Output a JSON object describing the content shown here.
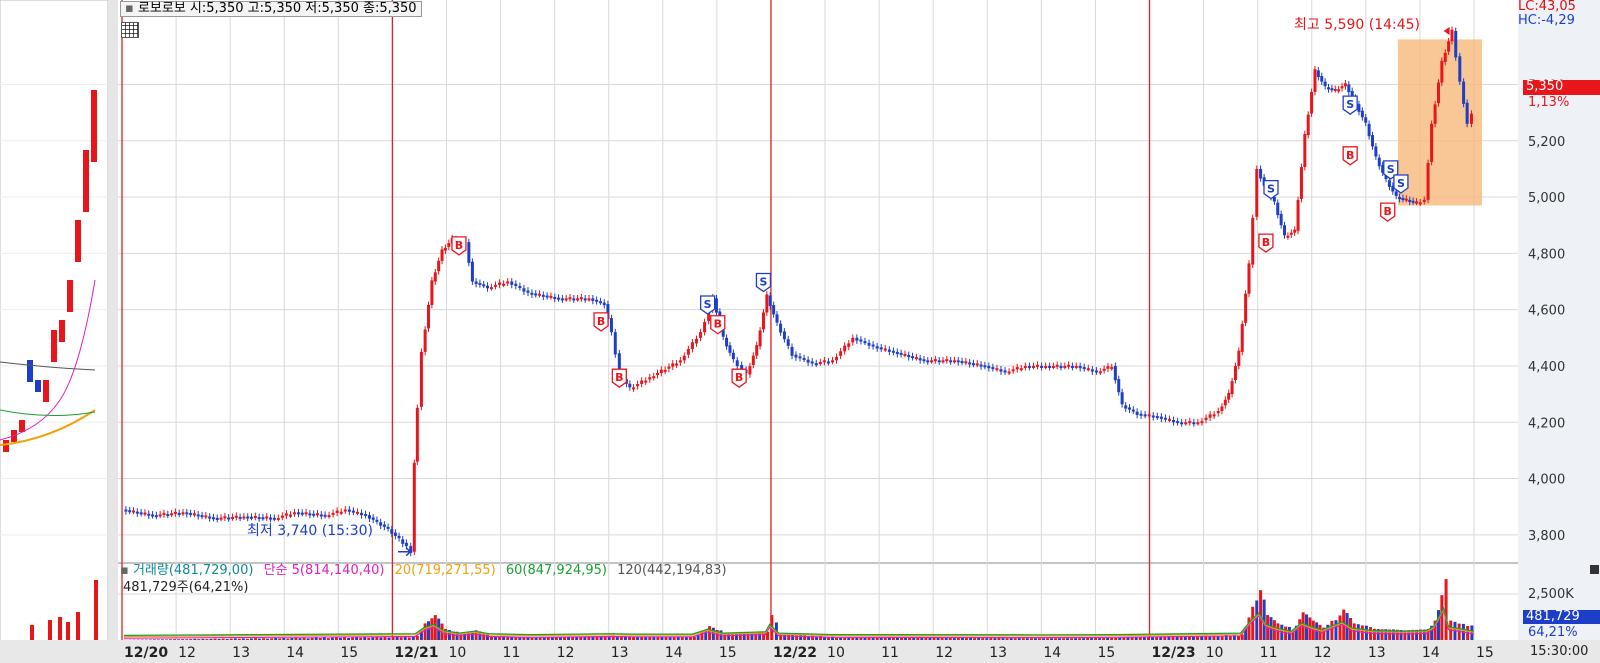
{
  "header": {
    "toggle": "▪",
    "info": "로보로보 시:5,350 고:5,350 저:5,350 종:5,350"
  },
  "corner": {
    "lc": "LC:43,05",
    "hc": "HC:-4,29"
  },
  "price_badge": {
    "value": "5,350",
    "change": "1,13%"
  },
  "annotations": {
    "high": "최고 5,590 (14:45)",
    "low": "최저 3,740 (15:30)"
  },
  "volume_header": {
    "volume": "거래량(481,729,00)",
    "ma5": "단순 5(814,140,40)",
    "ma20": "20(719,271,55)",
    "ma60": "60(847,924,95)",
    "ma120": "120(442,194,83)",
    "shares": "481,729주(64,21%)"
  },
  "volume_badge": {
    "value": "481,729",
    "pct": "64,21%"
  },
  "time_readout": "15:30:00",
  "colors": {
    "up": "#e8151b",
    "down": "#1d3fc8",
    "ma5": "#e020c0",
    "ma20": "#f2a20a",
    "ma60": "#1aa030",
    "ma120": "#555555",
    "volume_label": "#118899",
    "grid": "#d9d9d9",
    "session": "#e02020"
  },
  "chart_data": {
    "type": "candlestick",
    "title": "로보로보",
    "y_ticks": [
      "5,400",
      "5,200",
      "5,000",
      "4,800",
      "4,600",
      "4,400",
      "4,200",
      "4,000",
      "3,800"
    ],
    "y_range": [
      3700,
      5700
    ],
    "volume_ticks": [
      "2,500K"
    ],
    "x_ticks": [
      {
        "label": "12/20",
        "bold": true
      },
      {
        "label": "12"
      },
      {
        "label": "13"
      },
      {
        "label": "14"
      },
      {
        "label": "15"
      },
      {
        "label": "12/21",
        "bold": true
      },
      {
        "label": "10"
      },
      {
        "label": "11"
      },
      {
        "label": "12"
      },
      {
        "label": "13"
      },
      {
        "label": "14"
      },
      {
        "label": "15"
      },
      {
        "label": "12/22",
        "bold": true
      },
      {
        "label": "10"
      },
      {
        "label": "11"
      },
      {
        "label": "12"
      },
      {
        "label": "13"
      },
      {
        "label": "14"
      },
      {
        "label": "15"
      },
      {
        "label": "12/23",
        "bold": true
      },
      {
        "label": "10"
      },
      {
        "label": "11"
      },
      {
        "label": "12"
      },
      {
        "label": "13"
      },
      {
        "label": "14"
      },
      {
        "label": "15"
      }
    ],
    "price_path": [
      [
        0,
        3890
      ],
      [
        30,
        3870
      ],
      [
        60,
        3880
      ],
      [
        90,
        3860
      ],
      [
        120,
        3865
      ],
      [
        150,
        3860
      ],
      [
        170,
        3880
      ],
      [
        200,
        3870
      ],
      [
        220,
        3890
      ],
      [
        240,
        3870
      ],
      [
        262,
        3820
      ],
      [
        280,
        3760
      ],
      [
        285,
        3740
      ],
      [
        287,
        4060
      ],
      [
        295,
        4450
      ],
      [
        305,
        4700
      ],
      [
        315,
        4810
      ],
      [
        325,
        4850
      ],
      [
        338,
        4840
      ],
      [
        345,
        4700
      ],
      [
        360,
        4680
      ],
      [
        380,
        4700
      ],
      [
        400,
        4660
      ],
      [
        430,
        4640
      ],
      [
        460,
        4640
      ],
      [
        475,
        4620
      ],
      [
        482,
        4520
      ],
      [
        490,
        4370
      ],
      [
        500,
        4320
      ],
      [
        520,
        4360
      ],
      [
        550,
        4420
      ],
      [
        570,
        4520
      ],
      [
        582,
        4640
      ],
      [
        592,
        4500
      ],
      [
        602,
        4420
      ],
      [
        615,
        4370
      ],
      [
        625,
        4470
      ],
      [
        635,
        4650
      ],
      [
        645,
        4550
      ],
      [
        660,
        4440
      ],
      [
        680,
        4410
      ],
      [
        700,
        4420
      ],
      [
        720,
        4500
      ],
      [
        740,
        4470
      ],
      [
        760,
        4450
      ],
      [
        790,
        4420
      ],
      [
        820,
        4420
      ],
      [
        850,
        4400
      ],
      [
        870,
        4380
      ],
      [
        890,
        4400
      ],
      [
        910,
        4400
      ],
      [
        940,
        4400
      ],
      [
        960,
        4380
      ],
      [
        975,
        4400
      ],
      [
        985,
        4260
      ],
      [
        1000,
        4230
      ],
      [
        1020,
        4220
      ],
      [
        1040,
        4200
      ],
      [
        1060,
        4200
      ],
      [
        1080,
        4240
      ],
      [
        1090,
        4300
      ],
      [
        1100,
        4450
      ],
      [
        1110,
        4760
      ],
      [
        1118,
        5100
      ],
      [
        1125,
        5040
      ],
      [
        1135,
        4980
      ],
      [
        1145,
        4860
      ],
      [
        1155,
        4880
      ],
      [
        1165,
        5220
      ],
      [
        1175,
        5450
      ],
      [
        1185,
        5390
      ],
      [
        1195,
        5380
      ],
      [
        1205,
        5400
      ],
      [
        1215,
        5330
      ],
      [
        1225,
        5260
      ],
      [
        1235,
        5140
      ],
      [
        1245,
        5060
      ],
      [
        1255,
        5000
      ],
      [
        1265,
        4990
      ],
      [
        1275,
        4980
      ],
      [
        1283,
        4990
      ],
      [
        1290,
        5260
      ],
      [
        1300,
        5480
      ],
      [
        1310,
        5590
      ],
      [
        1318,
        5410
      ],
      [
        1325,
        5260
      ],
      [
        1330,
        5300
      ]
    ],
    "volume_path": [
      [
        0,
        10
      ],
      [
        287,
        150
      ],
      [
        295,
        600
      ],
      [
        305,
        900
      ],
      [
        315,
        400
      ],
      [
        330,
        200
      ],
      [
        345,
        350
      ],
      [
        360,
        150
      ],
      [
        400,
        80
      ],
      [
        480,
        150
      ],
      [
        500,
        120
      ],
      [
        560,
        120
      ],
      [
        575,
        500
      ],
      [
        590,
        200
      ],
      [
        632,
        300
      ],
      [
        636,
        900
      ],
      [
        645,
        200
      ],
      [
        700,
        80
      ],
      [
        900,
        60
      ],
      [
        975,
        80
      ],
      [
        1100,
        200
      ],
      [
        1110,
        1200
      ],
      [
        1118,
        1800
      ],
      [
        1125,
        900
      ],
      [
        1135,
        600
      ],
      [
        1150,
        350
      ],
      [
        1160,
        1000
      ],
      [
        1170,
        700
      ],
      [
        1180,
        450
      ],
      [
        1200,
        1100
      ],
      [
        1210,
        600
      ],
      [
        1230,
        400
      ],
      [
        1260,
        350
      ],
      [
        1283,
        400
      ],
      [
        1290,
        700
      ],
      [
        1300,
        2200
      ],
      [
        1305,
        700
      ],
      [
        1330,
        350
      ]
    ],
    "session_starts": [
      "12/21",
      "12/22",
      "12/23"
    ],
    "signals": [
      {
        "type": "B",
        "x": 330,
        "price": 4830
      },
      {
        "type": "B",
        "x": 470,
        "price": 4560
      },
      {
        "type": "B",
        "x": 488,
        "price": 4360
      },
      {
        "type": "S",
        "x": 575,
        "price": 4620
      },
      {
        "type": "B",
        "x": 585,
        "price": 4550
      },
      {
        "type": "B",
        "x": 606,
        "price": 4360
      },
      {
        "type": "S",
        "x": 630,
        "price": 4700
      },
      {
        "type": "S",
        "x": 1130,
        "price": 5030
      },
      {
        "type": "B",
        "x": 1125,
        "price": 4840
      },
      {
        "type": "S",
        "x": 1208,
        "price": 5330
      },
      {
        "type": "B",
        "x": 1208,
        "price": 5150
      },
      {
        "type": "S",
        "x": 1248,
        "price": 5100
      },
      {
        "type": "S",
        "x": 1258,
        "price": 5050
      },
      {
        "type": "B",
        "x": 1245,
        "price": 4950
      }
    ]
  }
}
